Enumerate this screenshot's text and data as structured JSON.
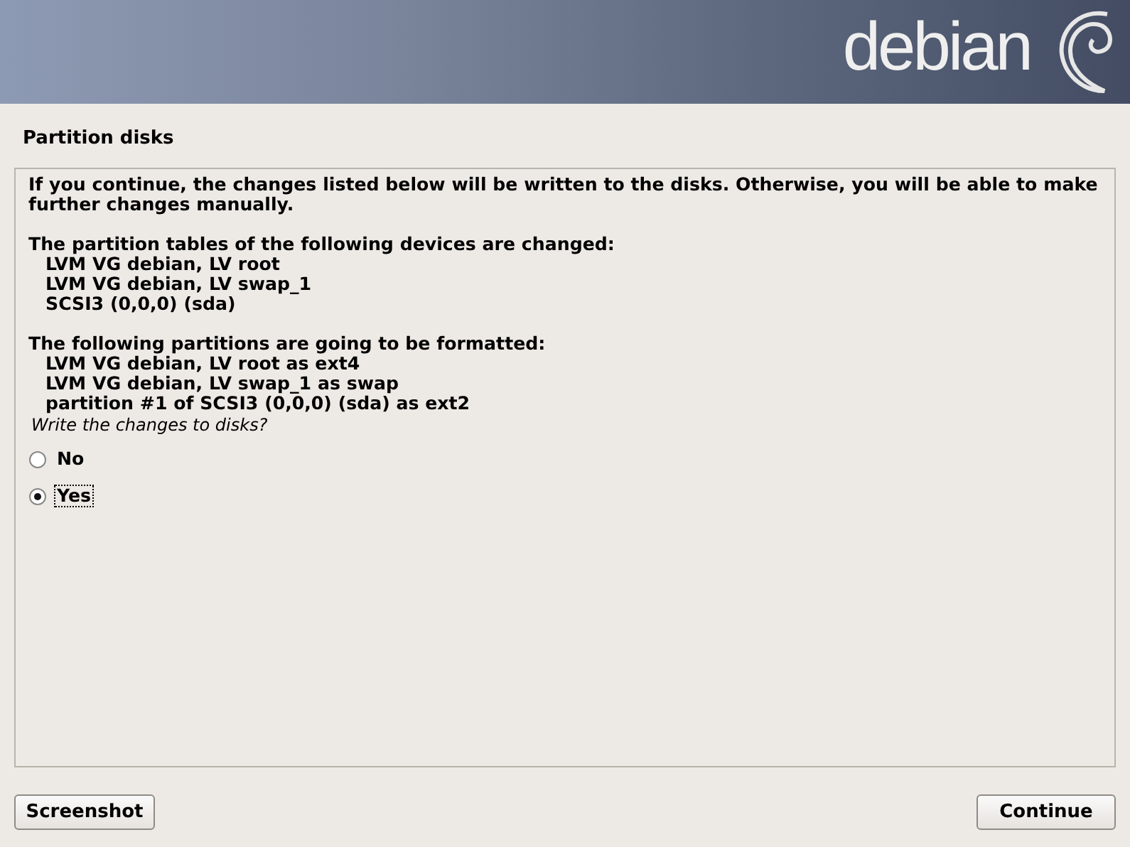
{
  "banner": {
    "logo_text": "debian"
  },
  "title": "Partition disks",
  "intro": "If you continue, the changes listed below will be written to the disks. Otherwise, you will be able to make further changes manually.",
  "sections": [
    {
      "heading": "The partition tables of the following devices are changed:",
      "items": [
        "LVM VG debian, LV root",
        "LVM VG debian, LV swap_1",
        "SCSI3 (0,0,0) (sda)"
      ]
    },
    {
      "heading": "The following partitions are going to be formatted:",
      "items": [
        "LVM VG debian, LV root as ext4",
        "LVM VG debian, LV swap_1 as swap",
        "partition #1 of SCSI3 (0,0,0) (sda) as ext2"
      ]
    }
  ],
  "question": "Write the changes to disks?",
  "options": [
    {
      "label": "No",
      "selected": false
    },
    {
      "label": "Yes",
      "selected": true
    }
  ],
  "buttons": {
    "left": "Screenshot",
    "right": "Continue"
  }
}
